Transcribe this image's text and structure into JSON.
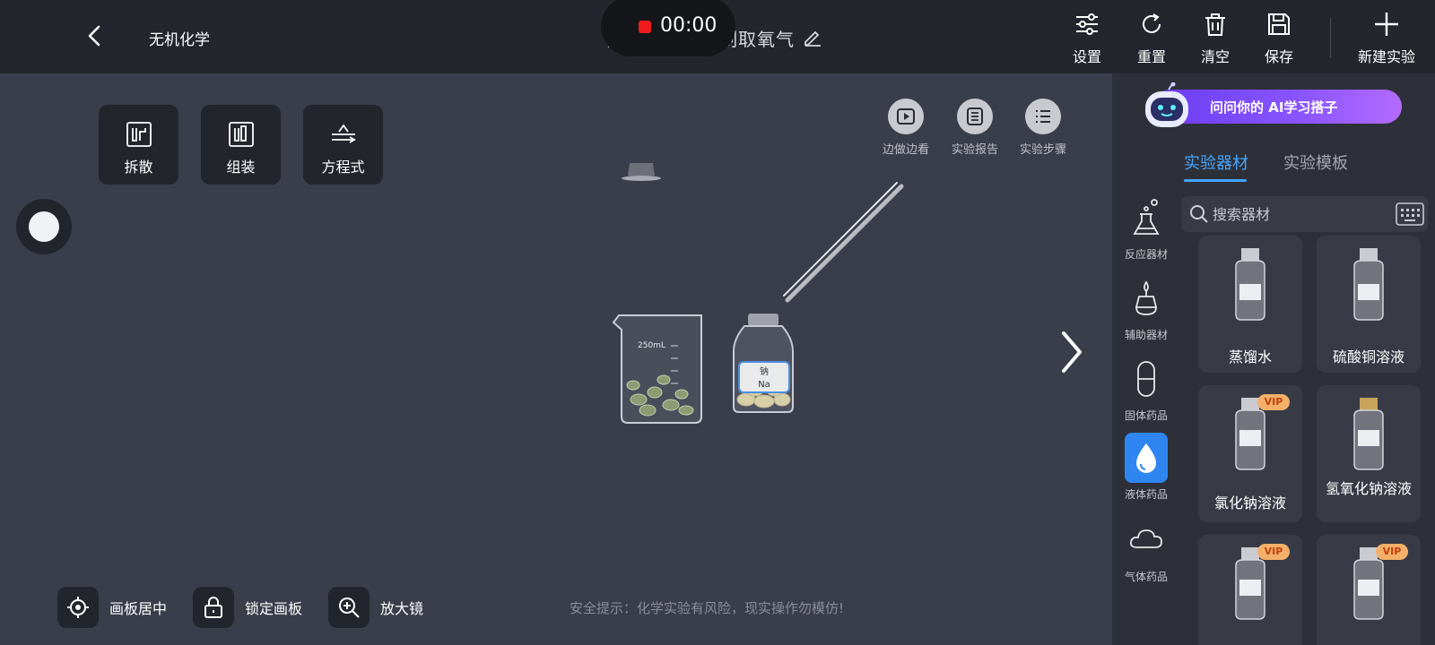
{
  "header": {
    "course_title": "无机化学",
    "experiment_title": "高锰酸钾分解制取氧气",
    "timer": "00:00",
    "actions": [
      {
        "label": "设置",
        "icon": "settings-sliders-icon"
      },
      {
        "label": "重置",
        "icon": "reset-icon"
      },
      {
        "label": "清空",
        "icon": "trash-icon"
      },
      {
        "label": "保存",
        "icon": "save-icon"
      },
      {
        "label": "新建实验",
        "icon": "plus-icon"
      }
    ]
  },
  "tools": [
    {
      "label": "拆散",
      "icon": "disassemble-icon"
    },
    {
      "label": "组装",
      "icon": "assemble-icon"
    },
    {
      "label": "方程式",
      "icon": "equation-icon"
    }
  ],
  "canvas_actions": [
    {
      "label": "边做边看",
      "icon": "play-icon"
    },
    {
      "label": "实验报告",
      "icon": "report-icon"
    },
    {
      "label": "实验步骤",
      "icon": "steps-icon"
    }
  ],
  "canvas_items": {
    "beaker_label": "250mL",
    "jar_label_cn": "钠",
    "jar_label_en": "Na"
  },
  "bottom_bar": {
    "center_label": "画板居中",
    "lock_label": "锁定画板",
    "magnifier_label": "放大镜",
    "safety_tip": "安全提示：化学实验有风险，现实操作勿模仿!"
  },
  "right_panel": {
    "ai_banner_text": "问问你的 AI学习搭子",
    "tabs": [
      "实验器材",
      "实验模板"
    ],
    "active_tab": "实验器材",
    "search_placeholder": "搜索器材",
    "categories": [
      {
        "label": "反应器材",
        "icon": "flask-icon"
      },
      {
        "label": "辅助器材",
        "icon": "burner-icon"
      },
      {
        "label": "固体药品",
        "icon": "capsule-icon"
      },
      {
        "label": "液体药品",
        "icon": "droplet-icon",
        "active": true
      },
      {
        "label": "气体药品",
        "icon": "cloud-icon"
      }
    ],
    "items": [
      {
        "name": "蒸馏水",
        "vip": false
      },
      {
        "name": "硫酸铜溶液",
        "vip": false
      },
      {
        "name": "氯化钠溶液",
        "vip": true
      },
      {
        "name": "氢氧化钠溶液",
        "vip": false
      },
      {
        "name": "",
        "vip": true
      },
      {
        "name": "",
        "vip": true
      }
    ],
    "vip_badge": "VIP"
  },
  "colors": {
    "background": "#3a3d4a",
    "topbar": "#24262d",
    "accent": "#44a6ff",
    "record": "#f01c1c"
  }
}
